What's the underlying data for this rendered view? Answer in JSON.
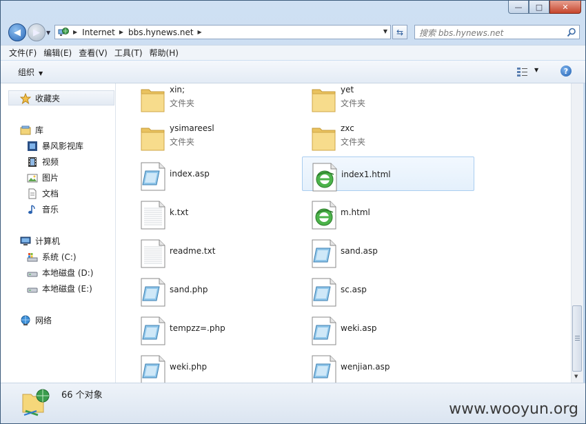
{
  "window": {
    "controls": {
      "minimize": "—",
      "maximize": "□",
      "close": "✕"
    }
  },
  "nav": {
    "breadcrumb": [
      "Internet",
      "bbs.hynews.net"
    ],
    "search_placeholder": "搜索 bbs.hynews.net"
  },
  "menu": [
    "文件(F)",
    "编辑(E)",
    "查看(V)",
    "工具(T)",
    "帮助(H)"
  ],
  "toolbar": {
    "organize": "组织",
    "help": "?"
  },
  "sidebar": {
    "favorites": "收藏夹",
    "libraries": "库",
    "library_items": [
      "暴风影视库",
      "视频",
      "图片",
      "文档",
      "音乐"
    ],
    "computer": "计算机",
    "drives": [
      "系统 (C:)",
      "本地磁盘 (D:)",
      "本地磁盘 (E:)"
    ],
    "network": "网络"
  },
  "files": [
    {
      "name": "xin;",
      "type": "文件夹",
      "icon": "folder-icon"
    },
    {
      "name": "yet",
      "type": "文件夹",
      "icon": "folder-icon"
    },
    {
      "name": "ysimareesl",
      "type": "文件夹",
      "icon": "folder-icon"
    },
    {
      "name": "zxc",
      "type": "文件夹",
      "icon": "folder-icon"
    },
    {
      "name": "index.asp",
      "icon": "script-file-icon"
    },
    {
      "name": "index1.html",
      "icon": "html-file-icon",
      "selected": true
    },
    {
      "name": "k.txt",
      "icon": "text-file-icon"
    },
    {
      "name": "m.html",
      "icon": "html-file-icon"
    },
    {
      "name": "readme.txt",
      "icon": "text-file-icon"
    },
    {
      "name": "sand.asp",
      "icon": "script-file-icon"
    },
    {
      "name": "sand.php",
      "icon": "script-file-icon"
    },
    {
      "name": "sc.asp",
      "icon": "script-file-icon"
    },
    {
      "name": "tempzz=.php",
      "icon": "script-file-icon"
    },
    {
      "name": "weki.asp",
      "icon": "script-file-icon"
    },
    {
      "name": "weki.php",
      "icon": "script-file-icon"
    },
    {
      "name": "wenjian.asp",
      "icon": "script-file-icon"
    }
  ],
  "status": {
    "count": "66 个对象"
  },
  "watermark": "www.wooyun.org"
}
